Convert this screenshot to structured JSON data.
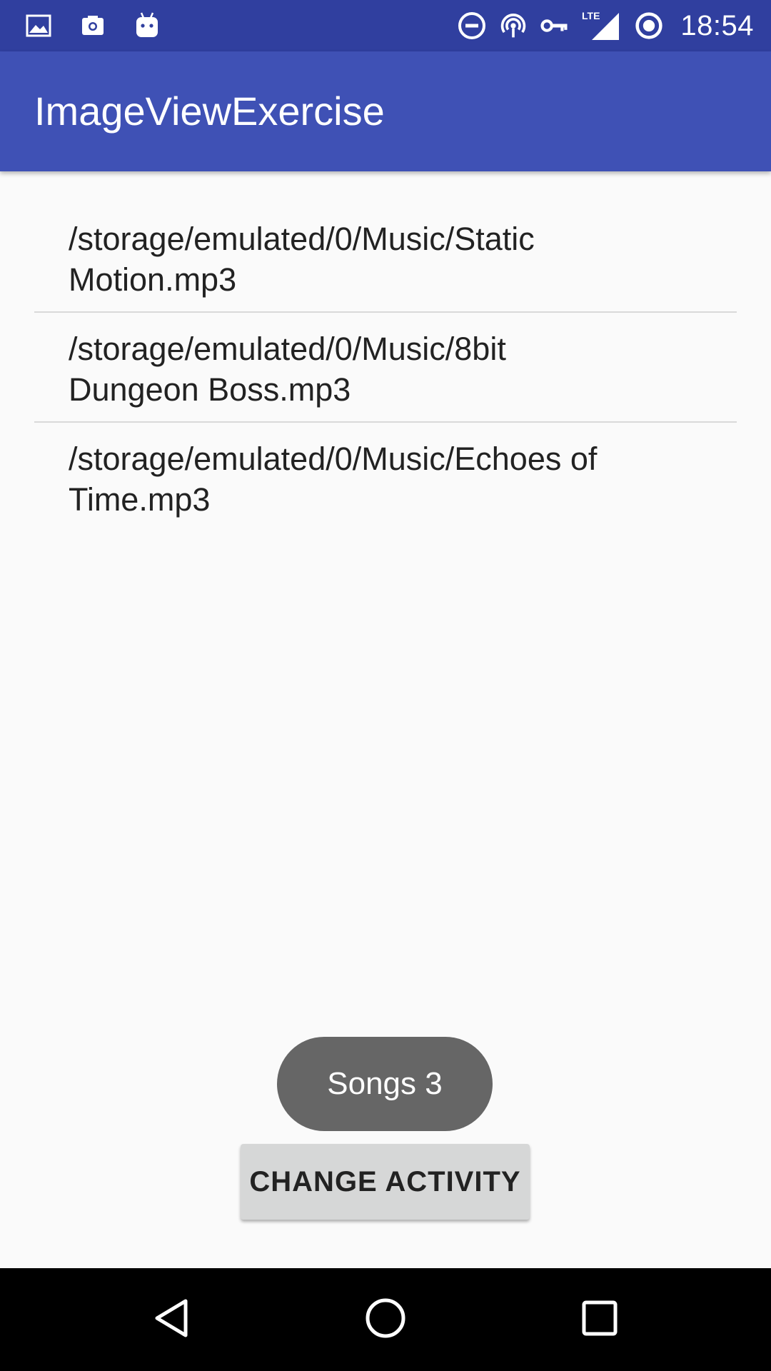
{
  "status_bar": {
    "time": "18:54",
    "network_label": "LTE",
    "left_icons": [
      "gallery-icon",
      "camera-icon",
      "android-icon"
    ],
    "right_icons": [
      "do-not-disturb-icon",
      "hotspot-icon",
      "vpn-key-icon",
      "lte-signal-icon",
      "sync-icon"
    ]
  },
  "app_bar": {
    "title": "ImageViewExercise"
  },
  "songs": [
    {
      "path": "/storage/emulated/0/Music/Static\nMotion.mp3"
    },
    {
      "path": "/storage/emulated/0/Music/8bit\nDungeon Boss.mp3"
    },
    {
      "path": "/storage/emulated/0/Music/Echoes of\nTime.mp3"
    }
  ],
  "toast": {
    "text": "Songs 3"
  },
  "button": {
    "label": "CHANGE ACTIVITY"
  },
  "nav_bar": {
    "icons": [
      "back-icon",
      "home-icon",
      "recents-icon"
    ]
  },
  "colors": {
    "status_bar": "#303f9f",
    "app_bar": "#3f51b5",
    "background": "#fafafa",
    "toast": "#666666",
    "button": "#d6d7d7",
    "nav_bar": "#000000"
  }
}
